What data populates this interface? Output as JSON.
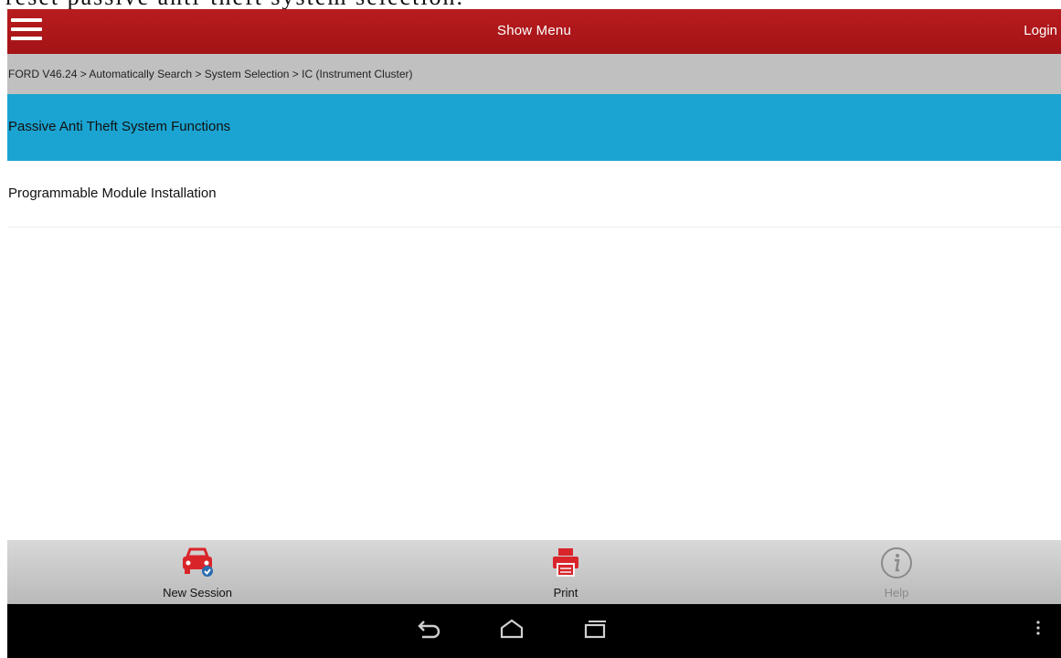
{
  "caption": {
    "text": "reset passive anti-theft system selection."
  },
  "app_bar": {
    "title": "Show Menu",
    "login_label": "Login"
  },
  "breadcrumb": {
    "text": "FORD V46.24 > Automatically Search > System Selection > IC (Instrument Cluster)"
  },
  "menu": {
    "items": [
      {
        "label": "Passive Anti Theft System Functions",
        "selected": true
      },
      {
        "label": "Programmable Module Installation",
        "selected": false
      }
    ]
  },
  "bottom_bar": {
    "new_session_label": "New Session",
    "print_label": "Print",
    "help_label": "Help"
  },
  "icons": {
    "menu": "hamburger-icon",
    "new_session": "car-check-icon",
    "print": "printer-icon",
    "help": "info-icon",
    "back": "back-icon",
    "home": "home-icon",
    "recents": "recents-icon",
    "overflow": "overflow-menu-icon"
  },
  "colors": {
    "app_bar": "#a91719",
    "selected_item": "#1ba4d2",
    "breadcrumb_bg": "#c0c0c0",
    "accent_red": "#d9252a"
  }
}
